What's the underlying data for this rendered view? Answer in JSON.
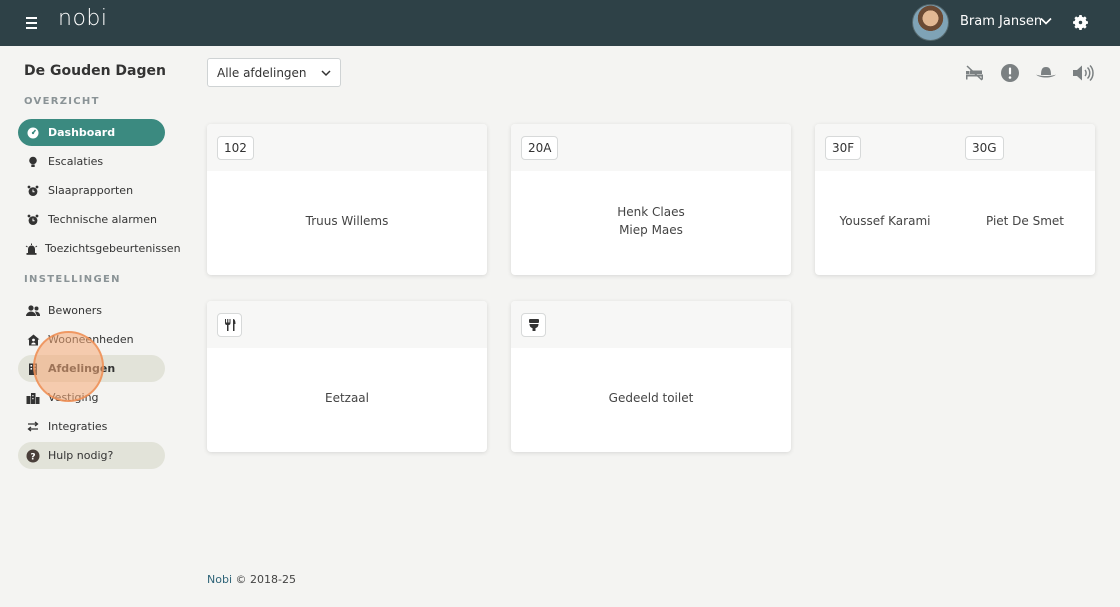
{
  "header": {
    "logo": "nobi",
    "user_name": "Bram Jansen"
  },
  "sidebar": {
    "site_title": "De Gouden Dagen",
    "sections": [
      {
        "label": "OVERZICHT"
      },
      {
        "label": "INSTELLINGEN"
      }
    ],
    "items": [
      {
        "label": "Dashboard",
        "icon": "dashboard-icon"
      },
      {
        "label": "Escalaties",
        "icon": "bulb-icon"
      },
      {
        "label": "Slaaprapporten",
        "icon": "alarm-clock-icon"
      },
      {
        "label": "Technische alarmen",
        "icon": "alarm-clock-icon"
      },
      {
        "label": "Toezichtsgebeurtenissen",
        "icon": "siren-icon"
      },
      {
        "label": "Bewoners",
        "icon": "users-icon"
      },
      {
        "label": "Wooneenheden",
        "icon": "home-user-icon"
      },
      {
        "label": "Afdelingen",
        "icon": "building-icon"
      },
      {
        "label": "Vestiging",
        "icon": "city-icon"
      },
      {
        "label": "Integraties",
        "icon": "swap-arrows-icon"
      },
      {
        "label": "Hulp nodig?",
        "icon": "question-circle-icon"
      }
    ]
  },
  "toolbar": {
    "department_select": "Alle afdelingen",
    "icons": [
      "bed-off-icon",
      "alert-circle-icon",
      "hat-icon",
      "volume-icon"
    ]
  },
  "cards": [
    {
      "rooms": [
        "102"
      ],
      "residents": [
        "Truus Willems"
      ]
    },
    {
      "rooms": [
        "20A"
      ],
      "residents": [
        "Henk Claes",
        "Miep Maes"
      ]
    },
    {
      "rooms": [
        "30F",
        "30G"
      ],
      "residents": [
        "Youssef Karami",
        "Piet De Smet"
      ]
    },
    {
      "room_icon": "cutlery-icon",
      "residents": [
        "Eetzaal"
      ]
    },
    {
      "room_icon": "toilet-icon",
      "residents": [
        "Gedeeld toilet"
      ]
    }
  ],
  "footer": {
    "brand": "Nobi",
    "copyright": "© 2018-25"
  },
  "colors": {
    "topbar": "#2e4147",
    "accent": "#3b8a80",
    "selected_bg": "#e2e3d9",
    "page_bg": "#f4f4f2"
  }
}
